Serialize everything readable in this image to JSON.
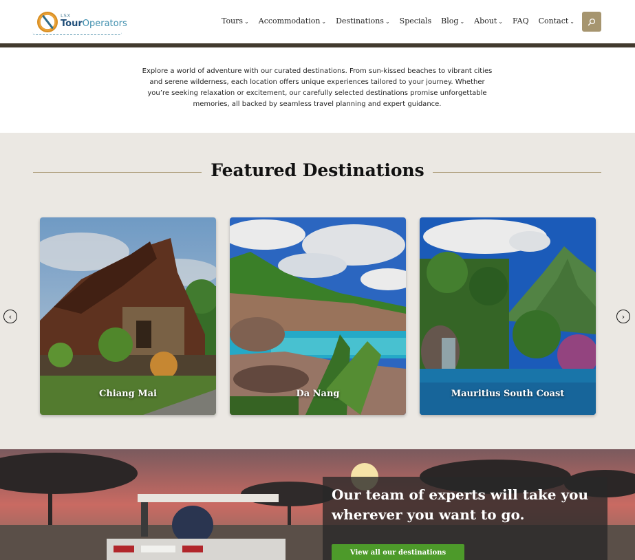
{
  "header": {
    "logo": {
      "small": "LSX",
      "brand_a": "Tour",
      "brand_b": "Operators"
    },
    "nav": [
      {
        "label": "Tours",
        "dropdown": true
      },
      {
        "label": "Accommodation",
        "dropdown": true
      },
      {
        "label": "Destinations",
        "dropdown": true
      },
      {
        "label": "Specials",
        "dropdown": false
      },
      {
        "label": "Blog",
        "dropdown": true
      },
      {
        "label": "About",
        "dropdown": true
      },
      {
        "label": "FAQ",
        "dropdown": false
      },
      {
        "label": "Contact",
        "dropdown": true
      }
    ],
    "search_icon": "search-icon"
  },
  "intro": {
    "text": "Explore a world of adventure with our curated destinations. From sun-kissed beaches to vibrant cities and serene wilderness, each location offers unique experiences tailored to your journey. Whether you’re seeking relaxation or excitement, our carefully selected destinations promise unforgettable memories, all backed by seamless travel planning and expert guidance."
  },
  "featured": {
    "title": "Featured Destinations",
    "cards": [
      {
        "label": "Chiang Mai"
      },
      {
        "label": "Da Nang"
      },
      {
        "label": "Mauritius South Coast"
      }
    ],
    "prev_icon": "chevron-left-icon",
    "next_icon": "chevron-right-icon"
  },
  "hero": {
    "title": "Our team of experts will take you wherever you want to go.",
    "button": "View all our destinations"
  },
  "colors": {
    "accent": "#a6956f",
    "header_bar": "#423a2e",
    "section_bg": "#ebe8e3",
    "button_green": "#4d9a2a"
  }
}
